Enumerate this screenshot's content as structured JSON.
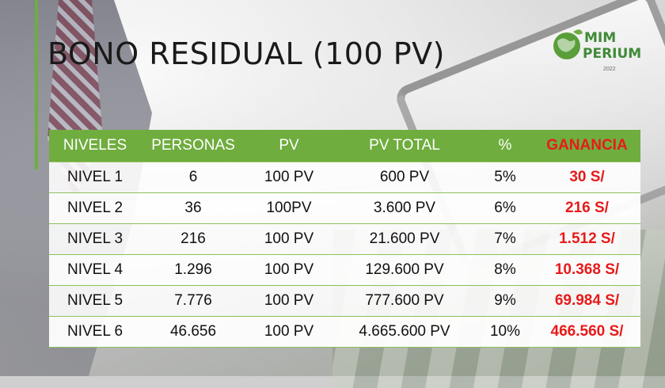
{
  "title": "BONO RESIDUAL (100 PV)",
  "logo": {
    "line1": "MIM",
    "line2": "PERIUM",
    "year": "2022"
  },
  "colors": {
    "accent_green": "#6fad3e",
    "ganancia_red": "#e81a1a"
  },
  "table": {
    "headers": {
      "niveles": "NIVELES",
      "personas": "PERSONAS",
      "pv": "PV",
      "pv_total": "PV TOTAL",
      "pct": "%",
      "ganancia": "GANANCIA"
    },
    "rows": [
      {
        "nivel": "NIVEL 1",
        "personas": "6",
        "pv": "100 PV",
        "pv_total": "600 PV",
        "pct": "5%",
        "ganancia": "30 S/"
      },
      {
        "nivel": "NIVEL 2",
        "personas": "36",
        "pv": "100PV",
        "pv_total": "3.600 PV",
        "pct": "6%",
        "ganancia": "216 S/"
      },
      {
        "nivel": "NIVEL 3",
        "personas": "216",
        "pv": "100 PV",
        "pv_total": "21.600 PV",
        "pct": "7%",
        "ganancia": "1.512 S/"
      },
      {
        "nivel": "NIVEL 4",
        "personas": "1.296",
        "pv": "100 PV",
        "pv_total": "129.600 PV",
        "pct": "8%",
        "ganancia": "10.368 S/"
      },
      {
        "nivel": "NIVEL 5",
        "personas": "7.776",
        "pv": "100 PV",
        "pv_total": "777.600 PV",
        "pct": "9%",
        "ganancia": "69.984 S/"
      },
      {
        "nivel": "NIVEL 6",
        "personas": "46.656",
        "pv": "100 PV",
        "pv_total": "4.665.600 PV",
        "pct": "10%",
        "ganancia": "466.560 S/"
      }
    ]
  }
}
